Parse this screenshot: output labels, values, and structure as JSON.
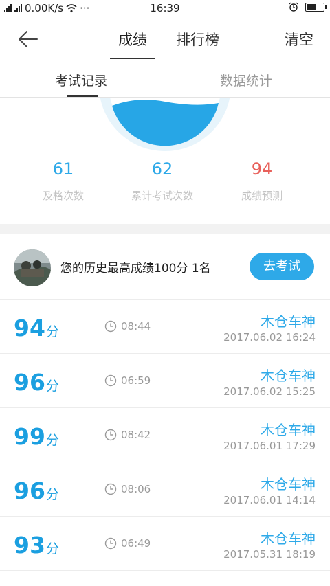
{
  "status_bar": {
    "network": "0.00K/s",
    "dots": "···",
    "time": "16:39",
    "battery_level": 0.55
  },
  "nav": {
    "tabs": [
      {
        "label": "成绩",
        "active": true
      },
      {
        "label": "排行榜",
        "active": false
      }
    ],
    "clear_label": "清空"
  },
  "sub_tabs": {
    "exam_records": "考试记录",
    "data_stats": "数据统计"
  },
  "stats": [
    {
      "value": "61",
      "label": "及格次数",
      "color": "#2ea9e8"
    },
    {
      "value": "62",
      "label": "累计考试次数",
      "color": "#2ea9e8"
    },
    {
      "value": "94",
      "label": "成绩预测",
      "color": "#e8605a"
    }
  ],
  "best": {
    "text": "您的历史最高成绩100分  1名",
    "button": "去考试"
  },
  "records": [
    {
      "score": "94",
      "unit": "分",
      "duration": "08:44",
      "name": "木仓车神",
      "date": "2017.06.02  16:24"
    },
    {
      "score": "96",
      "unit": "分",
      "duration": "06:59",
      "name": "木仓车神",
      "date": "2017.06.02  15:25"
    },
    {
      "score": "99",
      "unit": "分",
      "duration": "08:42",
      "name": "木仓车神",
      "date": "2017.06.01  17:29"
    },
    {
      "score": "96",
      "unit": "分",
      "duration": "08:06",
      "name": "木仓车神",
      "date": "2017.06.01  14:14"
    },
    {
      "score": "93",
      "unit": "分",
      "duration": "06:49",
      "name": "木仓车神",
      "date": "2017.05.31  18:19"
    }
  ],
  "colors": {
    "accent": "#2ea9e8",
    "score": "#1b9fe0",
    "prediction": "#e8605a"
  },
  "icons": {
    "back": "arrow-left-icon",
    "clock": "clock-icon",
    "wifi": "wifi-icon",
    "alarm": "alarm-icon"
  }
}
